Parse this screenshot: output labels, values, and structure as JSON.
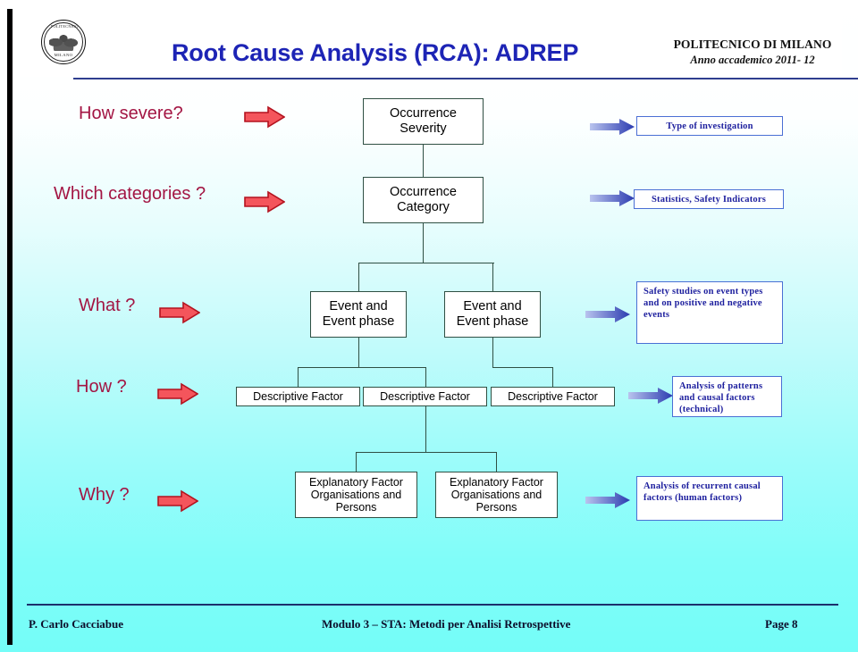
{
  "header": {
    "title": "Root Cause Analysis (RCA): ADREP",
    "university": "POLITECNICO DI MILANO",
    "academic_year": "Anno accademico 2011- 12",
    "logo_name": "politecnico-di-milano-seal",
    "logo_top_text": "POLITECNICO",
    "logo_bottom_text": "MILANO",
    "title_color": "#1d24b5",
    "rule_color": "#2f3e8f"
  },
  "questions": [
    {
      "label": "How severe?"
    },
    {
      "label": "Which categories ?"
    },
    {
      "label": "What ?"
    },
    {
      "label": "How ?"
    },
    {
      "label": "Why ?"
    }
  ],
  "tree": {
    "occurrence_severity": "Occurrence\nSeverity",
    "occurrence_severity_line1": "Occurrence",
    "occurrence_severity_line2": "Severity",
    "occurrence_category_line1": "Occurrence",
    "occurrence_category_line2": "Category",
    "event_phase_line1": "Event and",
    "event_phase_line2": "Event phase",
    "descriptive_factor": "Descriptive Factor",
    "explanatory_line1": "Explanatory Factor",
    "explanatory_line2": "Organisations and",
    "explanatory_line3": "Persons"
  },
  "outputs": [
    {
      "text": "Type of investigation"
    },
    {
      "text": "Statistics, Safety Indicators"
    },
    {
      "text": "Safety studies on event types and on positive and negative events"
    },
    {
      "text": "Analysis of patterns and causal factors (technical)"
    },
    {
      "text": "Analysis of recurrent causal factors (human factors)"
    }
  ],
  "footer": {
    "author": "P. Carlo Cacciabue",
    "module": "Modulo 3 – STA: Metodi per Analisi Retrospettive",
    "page": "Page 8"
  },
  "colors": {
    "question_text": "#a31543",
    "red_arrow_fill": "#f4555c",
    "red_arrow_stroke": "#b3121e",
    "blue_arrow": "#3a4fbf",
    "box_border": "#2f4f43",
    "right_box_border": "#4a6fd4",
    "right_box_text": "#1d1f9e",
    "background_top": "#ffffff",
    "background_bottom": "#74fdf8"
  }
}
